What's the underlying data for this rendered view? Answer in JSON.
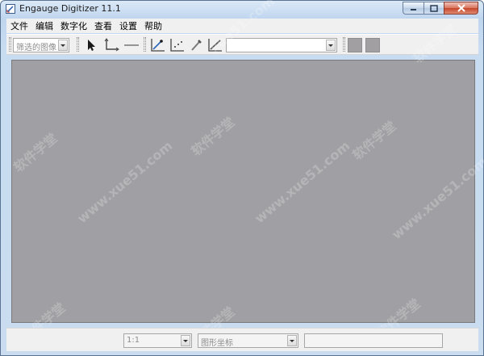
{
  "window": {
    "title": "Engauge Digitizer 11.1",
    "accent": "#bfd6ef"
  },
  "menu": {
    "items": [
      {
        "label": "文件"
      },
      {
        "label": "编辑"
      },
      {
        "label": "数字化"
      },
      {
        "label": "查看"
      },
      {
        "label": "设置"
      },
      {
        "label": "帮助"
      }
    ]
  },
  "toolbar": {
    "filter_combo": {
      "value": "筛选的图像"
    },
    "curve_combo": {
      "value": ""
    },
    "icons": [
      "select-arrow-icon",
      "axis-point-icon",
      "scale-bar-icon",
      "curve-point-icon",
      "point-match-icon",
      "color-picker-icon",
      "segment-fill-icon"
    ]
  },
  "canvas": {
    "background": "#a09fa3"
  },
  "statusbar": {
    "zoom": {
      "value": "1:1"
    },
    "coords_mode": {
      "value": "图形坐标"
    },
    "message": {
      "value": ""
    }
  },
  "watermark": {
    "text": "软件学堂 www.xue51.com"
  }
}
